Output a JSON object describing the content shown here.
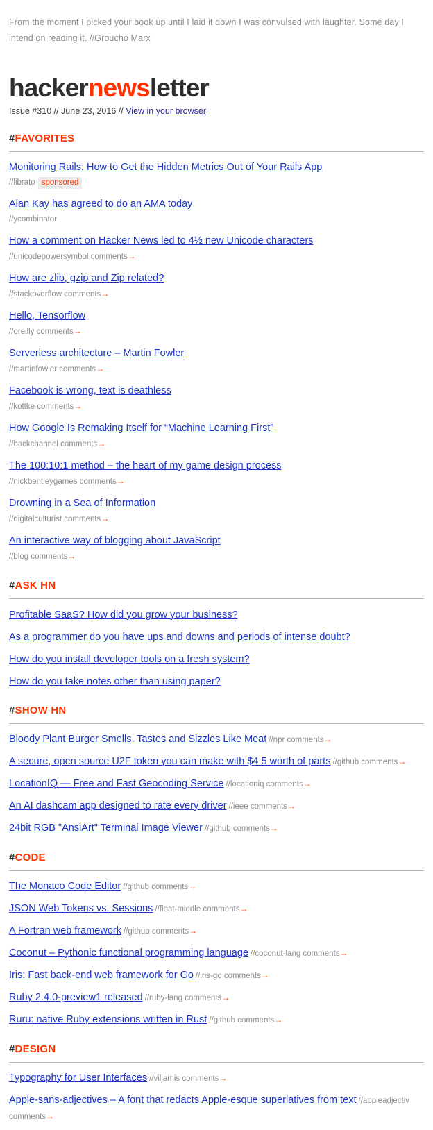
{
  "quote": {
    "text": "From the moment I picked your book up until I laid it down I was convulsed with laughter. Some day I intend on reading it. //Groucho Marx"
  },
  "masthead": {
    "logo_part1": "hacker",
    "logo_part2": "news",
    "logo_part3": "letter",
    "issue_prefix": "Issue #310 // June 23, 2016 // ",
    "browser_link": "View in your browser"
  },
  "colors": {
    "accent_red": "#ff3300",
    "link_blue": "#1a34c8",
    "meta_gray": "#8c8c8c",
    "arrow_orange": "#ff4b14",
    "badge_bg": "#ececec",
    "rule_gray": "#b9b9b9"
  },
  "arrow_glyph": "→",
  "comments_label": "comments",
  "sections": [
    {
      "hash": "#",
      "name": "FAVORITES",
      "layout": "stacked",
      "items": [
        {
          "title": "Monitoring Rails: How to Get the Hidden Metrics Out of Your Rails App",
          "source": "//librato",
          "comments": false,
          "badge": "sponsored"
        },
        {
          "title": "Alan Kay has agreed to do an AMA today",
          "source": "//ycombinator",
          "comments": false,
          "badge": null
        },
        {
          "title": "How a comment on Hacker News led to 4½ new Unicode characters",
          "source": "//unicodepowersymbol",
          "comments": true,
          "badge": null
        },
        {
          "title": "How are zlib, gzip and Zip related?",
          "source": "//stackoverflow",
          "comments": true,
          "badge": null
        },
        {
          "title": "Hello, Tensorflow",
          "source": "//oreilly",
          "comments": true,
          "badge": null
        },
        {
          "title": "Serverless architecture – Martin Fowler",
          "source": "//martinfowler",
          "comments": true,
          "badge": null
        },
        {
          "title": "Facebook is wrong, text is deathless",
          "source": "//kottke",
          "comments": true,
          "badge": null
        },
        {
          "title": "How Google Is Remaking Itself for “Machine Learning First”",
          "source": "//backchannel",
          "comments": true,
          "badge": null
        },
        {
          "title": "The 100:10:1 method – the heart of my game design process",
          "source": "//nickbentleygames",
          "comments": true,
          "badge": null
        },
        {
          "title": "Drowning in a Sea of Information",
          "source": "//digitalculturist",
          "comments": true,
          "badge": null
        },
        {
          "title": "An interactive way of blogging about JavaScript",
          "source": "//blog",
          "comments": true,
          "badge": null
        }
      ]
    },
    {
      "hash": "#",
      "name": "ASK HN",
      "layout": "title-only",
      "items": [
        {
          "title": "Profitable SaaS? How did you grow your business?",
          "source": null,
          "comments": false,
          "badge": null
        },
        {
          "title": "As a programmer do you have ups and downs and periods of intense doubt?",
          "source": null,
          "comments": false,
          "badge": null
        },
        {
          "title": "How do you install developer tools on a fresh system?",
          "source": null,
          "comments": false,
          "badge": null
        },
        {
          "title": "How do you take notes other than using paper?",
          "source": null,
          "comments": false,
          "badge": null
        }
      ]
    },
    {
      "hash": "#",
      "name": "SHOW HN",
      "layout": "inline",
      "items": [
        {
          "title": "Bloody Plant Burger Smells, Tastes and Sizzles Like Meat",
          "source": "//npr",
          "comments": true,
          "badge": null
        },
        {
          "title": "A secure, open source U2F token you can make with $4.5 worth of parts",
          "source": "//github",
          "comments": true,
          "badge": null
        },
        {
          "title": "LocationIQ — Free and Fast Geocoding Service",
          "source": "//locationiq",
          "comments": true,
          "badge": null
        },
        {
          "title": "An AI dashcam app designed to rate every driver",
          "source": "//ieee",
          "comments": true,
          "badge": null
        },
        {
          "title": "24bit RGB \"AnsiArt\" Terminal Image Viewer",
          "source": "//github",
          "comments": true,
          "badge": null
        }
      ]
    },
    {
      "hash": "#",
      "name": "CODE",
      "layout": "inline",
      "items": [
        {
          "title": "The Monaco Code Editor",
          "source": "//github",
          "comments": true,
          "badge": null
        },
        {
          "title": "JSON Web Tokens vs. Sessions",
          "source": "//float-middle",
          "comments": true,
          "badge": null
        },
        {
          "title": "A Fortran web framework",
          "source": "//github",
          "comments": true,
          "badge": null
        },
        {
          "title": "Coconut – Pythonic functional programming language",
          "source": "//coconut-lang",
          "comments": true,
          "badge": null
        },
        {
          "title": "Iris: Fast back-end web framework for Go",
          "source": "//iris-go",
          "comments": true,
          "badge": null
        },
        {
          "title": "Ruby 2.4.0-preview1 released",
          "source": "//ruby-lang",
          "comments": true,
          "badge": null
        },
        {
          "title": "Ruru: native Ruby extensions written in Rust",
          "source": "//github",
          "comments": true,
          "badge": null
        }
      ]
    },
    {
      "hash": "#",
      "name": "DESIGN",
      "layout": "inline",
      "items": [
        {
          "title": "Typography for User Interfaces",
          "source": "//viljamis",
          "comments": true,
          "badge": null
        },
        {
          "title": "Apple-sans-adjectives – A font that redacts Apple-esque superlatives from text",
          "source": "//appleadjectiv",
          "comments": true,
          "badge": null
        }
      ]
    }
  ]
}
